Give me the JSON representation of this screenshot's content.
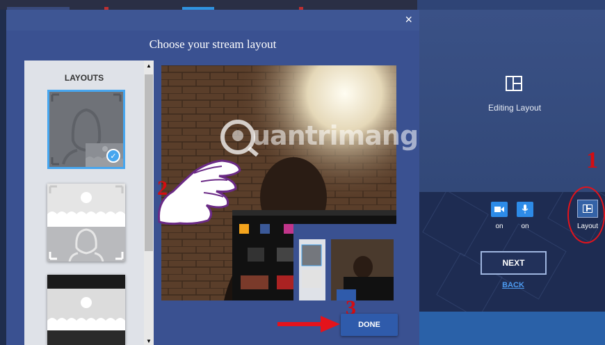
{
  "modal": {
    "title": "Choose your stream layout",
    "close_glyph": "×",
    "layouts_heading": "LAYOUTS",
    "done_label": "DONE",
    "selected_layout_index": 0
  },
  "right_panel": {
    "editing_label": "Editing Layout",
    "camera_label": "on",
    "mic_label": "on",
    "layout_label": "Layout",
    "next_label": "NEXT",
    "back_label": "BACK"
  },
  "annotations": {
    "step1": "1",
    "step2": "2",
    "step3": "3"
  },
  "watermark": {
    "text": "uantrimang"
  },
  "colors": {
    "accent": "#2d8be8",
    "modal_bg": "#3a5191",
    "annotation_red": "#d40d12",
    "selection_blue": "#47a6ef"
  }
}
